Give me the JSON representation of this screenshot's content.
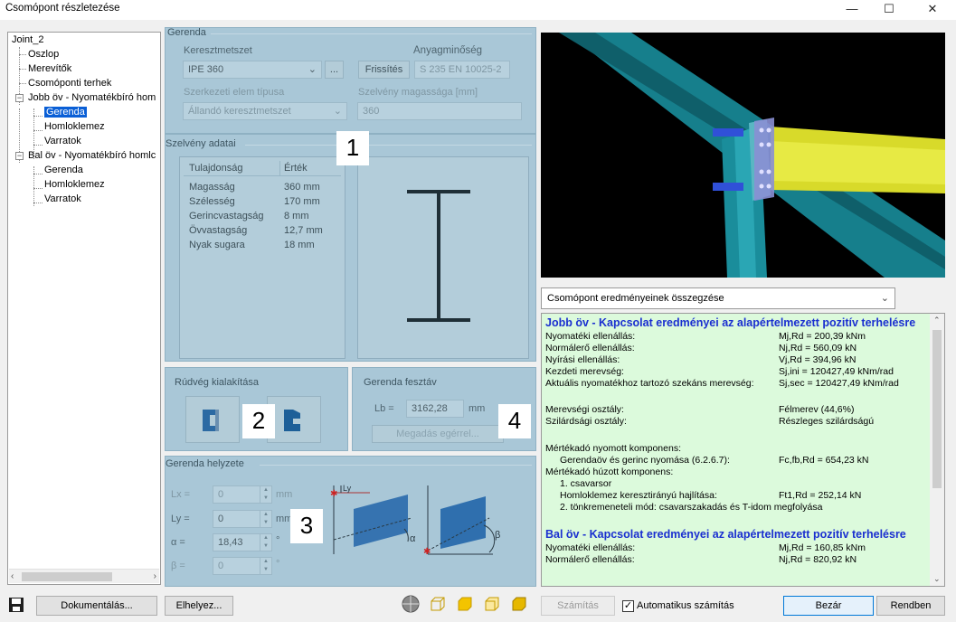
{
  "window": {
    "title": "Csomópont részletezése",
    "min_icon": "minimize-icon",
    "max_icon": "maximize-icon",
    "close_icon": "close-icon"
  },
  "tree": {
    "root": "Joint_2",
    "items": {
      "oszlop": "Oszlop",
      "merevitok": "Merevítők",
      "terhek": "Csomóponti terhek",
      "jobb": "Jobb öv - Nyomatékbíró hom",
      "jobb_gerenda": "Gerenda",
      "jobb_homlok": "Homloklemez",
      "jobb_varrat": "Varratok",
      "bal": "Bal öv - Nyomatékbíró homlc",
      "bal_gerenda": "Gerenda",
      "bal_homlok": "Homloklemez",
      "bal_varrat": "Varratok"
    }
  },
  "gerenda": {
    "group_title": "Gerenda",
    "keresztmetszet_label": "Keresztmetszet",
    "keresztmetszet_value": "IPE 360",
    "more_button": "...",
    "anyag_label": "Anyagminőség",
    "frissites_button": "Frissítés",
    "anyag_value": "S 235 EN 10025-2",
    "elemtipus_label": "Szerkezeti elem típusa",
    "elemtipus_value": "Állandó keresztmetszet",
    "magassag_label": "Szelvény magassága [mm]",
    "magassag_value": "360"
  },
  "szelveny": {
    "group_title": "Szelvény adatai",
    "col_prop": "Tulajdonság",
    "col_val": "Érték",
    "rows": [
      {
        "k": "Magasság",
        "v": "360 mm"
      },
      {
        "k": "Szélesség",
        "v": "170 mm"
      },
      {
        "k": "Gerincvastagság",
        "v": "8 mm"
      },
      {
        "k": "Övvastagság",
        "v": "12,7 mm"
      },
      {
        "k": "Nyak sugara",
        "v": "18 mm"
      }
    ]
  },
  "rudveg": {
    "group_title": "Rúdvég kialakítása"
  },
  "fesztav": {
    "group_title": "Gerenda fesztáv",
    "lb_label": "Lb =",
    "lb_value": "3162,28",
    "unit": "mm",
    "eger_button": "Megadás egérrel..."
  },
  "helyzet": {
    "group_title": "Gerenda helyzete",
    "lx_label": "Lx =",
    "lx_value": "0",
    "lx_unit": "mm",
    "ly_label": "Ly =",
    "ly_value": "0",
    "ly_unit": "mm",
    "alpha_label": "α =",
    "alpha_value": "18,43",
    "alpha_unit": "°",
    "beta_label": "β =",
    "beta_value": "0",
    "beta_unit": "°",
    "diag_ly": "Ly",
    "diag_alpha": "α",
    "diag_beta": "β"
  },
  "callouts": {
    "c1": "1",
    "c2": "2",
    "c3": "3",
    "c4": "4"
  },
  "results": {
    "dropdown_value": "Csomópont eredményeinek összegzése",
    "lines": [
      {
        "l": "Jobb öv - Kapcsolat eredményei az alapértelmezett pozitív terhelésre",
        "r": "",
        "head": true
      },
      {
        "l": "Nyomatéki ellenállás:",
        "r": "Mj,Rd = 200,39 kNm"
      },
      {
        "l": "Normálerő ellenállás:",
        "r": "Nj,Rd = 560,09 kN"
      },
      {
        "l": "Nyírási ellenállás:",
        "r": "Vj,Rd = 394,96 kN"
      },
      {
        "l": "Kezdeti merevség:",
        "r": "Sj,ini = 120427,49 kNm/rad"
      },
      {
        "l": "Aktuális nyomatékhoz tartozó szekáns merevség:",
        "r": "Sj,sec = 120427,49 kNm/rad"
      },
      {
        "l": "",
        "r": ""
      },
      {
        "l": "Merevségi osztály:",
        "r": "Félmerev (44,6%)"
      },
      {
        "l": "Szilárdsági osztály:",
        "r": "Részleges szilárdságú"
      },
      {
        "l": "",
        "r": ""
      },
      {
        "l": "Mértékadó nyomott komponens:",
        "r": ""
      },
      {
        "l": "    Gerendaöv és gerinc nyomása (6.2.6.7):",
        "r": "Fc,fb,Rd = 654,23 kN"
      },
      {
        "l": "Mértékadó húzott komponens:",
        "r": ""
      },
      {
        "l": "    1. csavarsor",
        "r": ""
      },
      {
        "l": "    Homloklemez keresztirányú hajlítása:",
        "r": "Ft1,Rd = 252,14 kN"
      },
      {
        "l": "    2. tönkremeneteli mód: csavarszakadás és T-idom megfolyása",
        "r": ""
      },
      {
        "l": "",
        "r": ""
      },
      {
        "l": "Bal öv - Kapcsolat eredményei az alapértelmezett pozitív terhelésre",
        "r": "",
        "head": true
      },
      {
        "l": "Nyomatéki ellenállás:",
        "r": "Mj,Rd = 160,85 kNm"
      },
      {
        "l": "Normálerő ellenállás:",
        "r": "Nj,Rd = 820,92 kN"
      }
    ]
  },
  "bottom": {
    "dokumentalas": "Dokumentálás...",
    "elhelyez": "Elhelyez...",
    "szamitas": "Számítás",
    "auto_label": "Automatikus számítás",
    "bezar": "Bezár",
    "rendben": "Rendben"
  }
}
